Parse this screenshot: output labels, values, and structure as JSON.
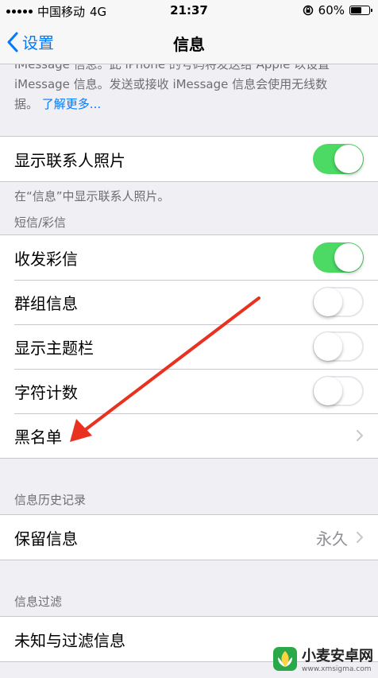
{
  "status_bar": {
    "carrier": "中国移动",
    "network": "4G",
    "time": "21:37",
    "battery": "60%",
    "battery_level": 0.6
  },
  "nav": {
    "back_label": "设置",
    "title": "信息"
  },
  "imessage_footer": {
    "line1": "iMessage 信息。此 iPhone 的号码将发送给 Apple 以设置",
    "line2": "iMessage 信息。发送或接收 iMessage 信息会使用无线数",
    "line3_prefix": "据。",
    "learn_more": "了解更多..."
  },
  "contact_photos": {
    "label": "显示联系人照片",
    "on": true,
    "footer": "在“信息”中显示联系人照片。"
  },
  "sms_section": {
    "header": "短信/彩信",
    "rows": [
      {
        "label": "收发彩信",
        "on": true
      },
      {
        "label": "群组信息",
        "on": false
      },
      {
        "label": "显示主题栏",
        "on": false
      },
      {
        "label": "字符计数",
        "on": false
      }
    ],
    "blocked_label": "黑名单"
  },
  "history_section": {
    "header": "信息历史记录",
    "keep_label": "保留信息",
    "keep_value": "永久"
  },
  "filter_section": {
    "header": "信息过滤",
    "unknown_label": "未知与过滤信息"
  },
  "watermark": {
    "title": "小麦安卓网",
    "url": "www.xmsigma.com"
  },
  "colors": {
    "accent": "#007aff",
    "toggle_on": "#4cd964",
    "annotation_arrow": "#e8321f"
  }
}
